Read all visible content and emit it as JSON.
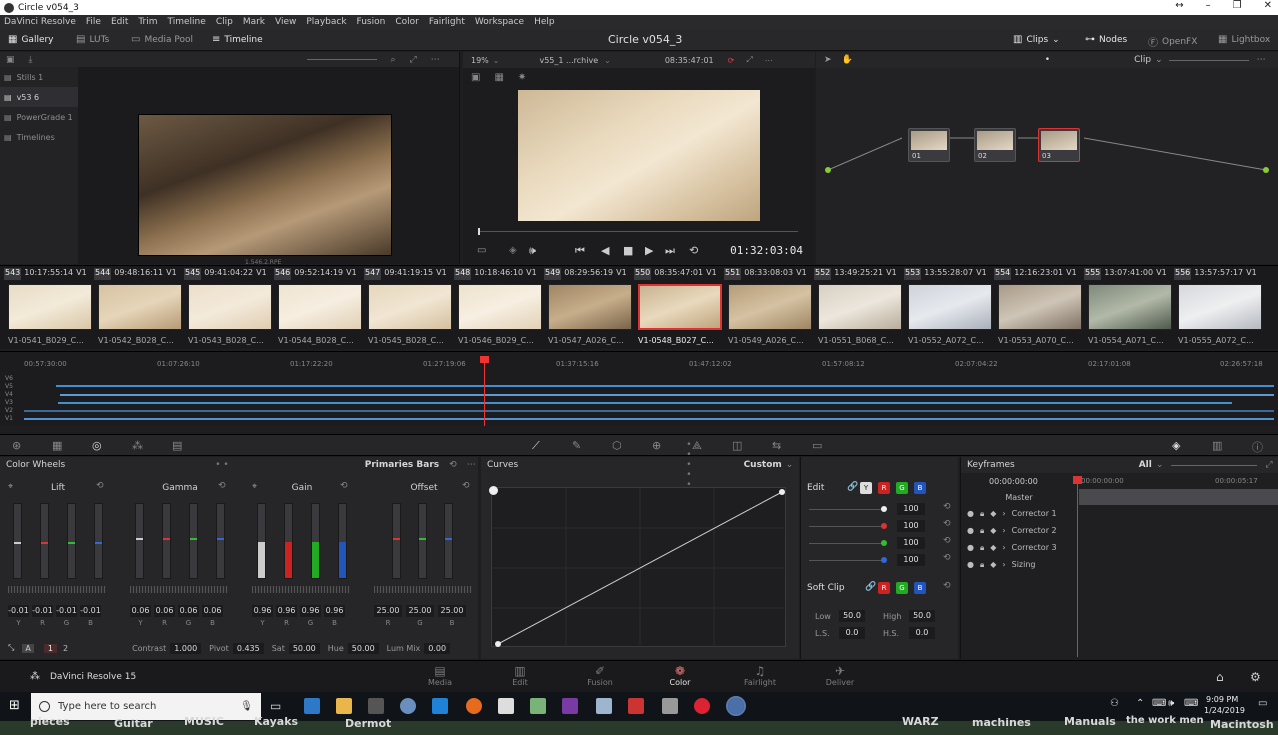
{
  "window": {
    "title": "Circle v054_3"
  },
  "menu": [
    "DaVinci Resolve",
    "File",
    "Edit",
    "Trim",
    "Timeline",
    "Clip",
    "Mark",
    "View",
    "Playback",
    "Fusion",
    "Color",
    "Fairlight",
    "Workspace",
    "Help"
  ],
  "toolbar": {
    "gallery": "Gallery",
    "luts": "LUTs",
    "media_pool": "Media Pool",
    "timeline": "Timeline",
    "project_title": "Circle v054_3",
    "clips": "Clips",
    "nodes": "Nodes",
    "openfx": "OpenFX",
    "lightbox": "Lightbox"
  },
  "gallery": {
    "items": [
      "Stills 1",
      "v53 6",
      "PowerGrade 1",
      "Timelines"
    ],
    "still_caption": "1.546.2.RPE"
  },
  "viewer": {
    "zoom": "19%",
    "clip_name": "v55_1 ...rchive",
    "timecode": "08:35:47:01",
    "playhead_tc": "01:32:03:04"
  },
  "nodes_panel": {
    "mode": "Clip",
    "nodes": [
      {
        "label": "01"
      },
      {
        "label": "02"
      },
      {
        "label": "03"
      }
    ]
  },
  "clips": [
    {
      "num": "543",
      "tc": "10:17:55:14",
      "track": "V1",
      "name": "V1-0541_B029_C..."
    },
    {
      "num": "544",
      "tc": "09:48:16:11",
      "track": "V1",
      "name": "V1-0542_B028_C..."
    },
    {
      "num": "545",
      "tc": "09:41:04:22",
      "track": "V1",
      "name": "V1-0543_B028_C..."
    },
    {
      "num": "546",
      "tc": "09:52:14:19",
      "track": "V1",
      "name": "V1-0544_B028_C..."
    },
    {
      "num": "547",
      "tc": "09:41:19:15",
      "track": "V1",
      "name": "V1-0545_B028_C..."
    },
    {
      "num": "548",
      "tc": "10:18:46:10",
      "track": "V1",
      "name": "V1-0546_B029_C..."
    },
    {
      "num": "549",
      "tc": "08:29:56:19",
      "track": "V1",
      "name": "V1-0547_A026_C..."
    },
    {
      "num": "550",
      "tc": "08:35:47:01",
      "track": "V1",
      "name": "V1-0548_B027_C..."
    },
    {
      "num": "551",
      "tc": "08:33:08:03",
      "track": "V1",
      "name": "V1-0549_A026_C..."
    },
    {
      "num": "552",
      "tc": "13:49:25:21",
      "track": "V1",
      "name": "V1-0551_B068_C..."
    },
    {
      "num": "553",
      "tc": "13:55:28:07",
      "track": "V1",
      "name": "V1-0552_A072_C..."
    },
    {
      "num": "554",
      "tc": "12:16:23:01",
      "track": "V1",
      "name": "V1-0553_A070_C..."
    },
    {
      "num": "555",
      "tc": "13:07:41:00",
      "track": "V1",
      "name": "V1-0554_A071_C..."
    },
    {
      "num": "556",
      "tc": "13:57:57:17",
      "track": "V1",
      "name": "V1-0555_A072_C..."
    }
  ],
  "timeline": {
    "ticks": [
      "00:57:30:00",
      "01:07:26:10",
      "01:17:22:20",
      "01:27:19:06",
      "01:37:15:16",
      "01:47:12:02",
      "01:57:08:12",
      "02:07:04:22",
      "02:17:01:08",
      "02:26:57:18"
    ],
    "tracks": [
      "V6",
      "V5",
      "V4",
      "V3",
      "V2",
      "V1"
    ]
  },
  "color_wheels": {
    "title": "Color Wheels",
    "mode": "Primaries Bars",
    "groups": [
      {
        "name": "Lift",
        "values": [
          "-0.01",
          "-0.01",
          "-0.01",
          "-0.01"
        ],
        "channels": [
          "Y",
          "R",
          "G",
          "B"
        ]
      },
      {
        "name": "Gamma",
        "values": [
          "0.06",
          "0.06",
          "0.06",
          "0.06"
        ],
        "channels": [
          "Y",
          "R",
          "G",
          "B"
        ]
      },
      {
        "name": "Gain",
        "values": [
          "0.96",
          "0.96",
          "0.96",
          "0.96"
        ],
        "channels": [
          "Y",
          "R",
          "G",
          "B"
        ]
      },
      {
        "name": "Offset",
        "values": [
          "25.00",
          "25.00",
          "25.00"
        ],
        "channels": [
          "R",
          "G",
          "B"
        ]
      }
    ],
    "adjust": {
      "contrast_label": "Contrast",
      "contrast": "1.000",
      "pivot_label": "Pivot",
      "pivot": "0.435",
      "sat_label": "Sat",
      "sat": "50.00",
      "hue_label": "Hue",
      "hue": "50.00",
      "lummix_label": "Lum Mix",
      "lummix": "0.00",
      "page1": "1",
      "page2": "2"
    }
  },
  "curves": {
    "title": "Curves",
    "mode": "Custom"
  },
  "edit_panel": {
    "title": "Edit",
    "channels": [
      "Y",
      "R",
      "G",
      "B"
    ],
    "values": [
      "100",
      "100",
      "100",
      "100"
    ],
    "soft_clip": "Soft Clip",
    "low_label": "Low",
    "low": "50.0",
    "high_label": "High",
    "high": "50.0",
    "ls_label": "L.S.",
    "ls": "0.0",
    "hs_label": "H.S.",
    "hs": "0.0"
  },
  "keyframes": {
    "title": "Keyframes",
    "filter": "All",
    "tc_start": "00:00:00:00",
    "tc_ruler_a": "00:00:00:00",
    "tc_ruler_b": "00:00:05:17",
    "rows": [
      "Master",
      "Corrector 1",
      "Corrector 2",
      "Corrector 3",
      "Sizing"
    ]
  },
  "pages": {
    "app": "DaVinci Resolve 15",
    "items": [
      "Media",
      "Edit",
      "Fusion",
      "Color",
      "Fairlight",
      "Deliver"
    ]
  },
  "taskbar": {
    "search_placeholder": "Type here to search",
    "time": "9:09 PM",
    "date": "1/24/2019"
  },
  "desktop_labels": [
    "pieces",
    "Guitar",
    "MUSIC",
    "Kayaks",
    "Dermot",
    "WARZ",
    "machines",
    "Manuals",
    "the work  men",
    "Macintosh"
  ]
}
